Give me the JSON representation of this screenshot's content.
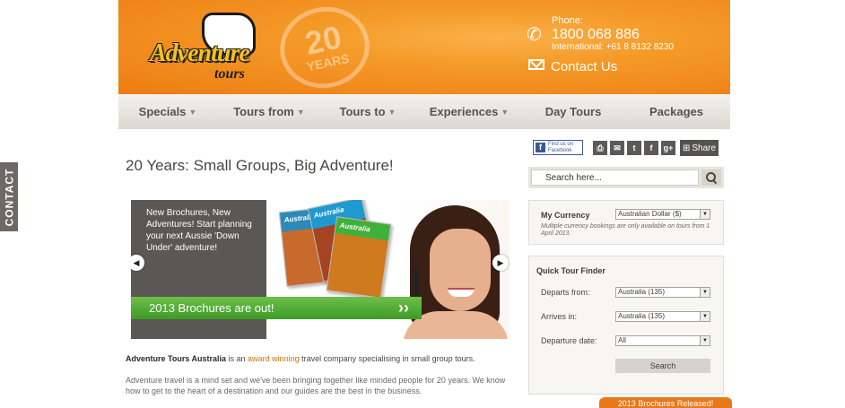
{
  "side_tab": {
    "label": "CONTACT"
  },
  "header": {
    "logo_main": "Adventure",
    "logo_sub": "tours",
    "stamp_number": "20",
    "stamp_word": "YEARS",
    "phone_label": "Phone:",
    "phone_number": "1800 068 886",
    "international": "International: +61 8 8132 8230",
    "contact_us": "Contact Us"
  },
  "nav": {
    "items": [
      {
        "label": "Specials",
        "has_menu": true
      },
      {
        "label": "Tours from",
        "has_menu": true
      },
      {
        "label": "Tours to",
        "has_menu": true
      },
      {
        "label": "Experiences",
        "has_menu": true
      },
      {
        "label": "Day Tours",
        "has_menu": false
      },
      {
        "label": "Packages",
        "has_menu": false
      }
    ]
  },
  "main": {
    "title": "20 Years: Small Groups, Big Adventure!",
    "slider": {
      "caption": "New Brochures, New Adventures! Start planning your next Aussie 'Down Under' adventure!",
      "banner": "2013 Brochures are out!",
      "brochure_1": "Australia",
      "brochure_2": "Australia",
      "brochure_3": "Australia"
    },
    "intro_company": "Adventure Tours Australia",
    "intro_is_an": " is an ",
    "intro_link": "award winning",
    "intro_rest": " travel company specialising in small group tours.",
    "intro_paragraph": "Adventure travel is a mind set and we've been bringing together like minded people for 20 years. We know how to get to the heart of a destination and our guides are the best in the business."
  },
  "social": {
    "facebook_badge": "Find us on Facebook",
    "icons": [
      "print-icon",
      "email-icon",
      "twitter-icon",
      "facebook-icon",
      "google-plus-icon"
    ],
    "share_label": "Share"
  },
  "search": {
    "placeholder": "Search here..."
  },
  "currency": {
    "label": "My Currency",
    "selected": "Australian Dollar ($)",
    "note": "Multiple currency bookings are only available on tours from 1 April 2013."
  },
  "finder": {
    "title": "Quick Tour Finder",
    "departs_label": "Departs from:",
    "departs_value": "Australia (135)",
    "arrives_label": "Arrives in:",
    "arrives_value": "Australia (135)",
    "date_label": "Departure date:",
    "date_value": "All",
    "search_button": "Search"
  },
  "promo_tab": {
    "label": "2013 Brochures Released!"
  },
  "colors": {
    "brand_orange": "#ee7c12",
    "green_banner": "#4fa82f",
    "link_orange": "#e06e14"
  }
}
